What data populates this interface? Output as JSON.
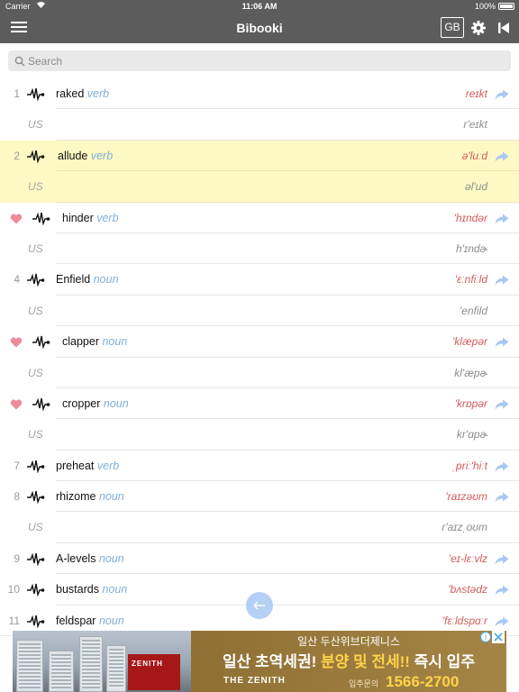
{
  "status_bar": {
    "carrier": "Carrier",
    "time": "11:06 AM",
    "battery": "100%"
  },
  "nav": {
    "title": "Bibooki",
    "lang_button": "GB"
  },
  "search": {
    "placeholder": "Search"
  },
  "entries": [
    {
      "num": "1",
      "fav": false,
      "word": "raked",
      "pos": "verb",
      "ipa": "reɪkt",
      "us_label": "US",
      "us_ipa": "r'eɪkt",
      "highlight": false
    },
    {
      "num": "2",
      "fav": false,
      "word": "allude",
      "pos": "verb",
      "ipa": "ə'luːd",
      "us_label": "US",
      "us_ipa": "əl'ud",
      "highlight": true
    },
    {
      "num": "",
      "fav": true,
      "word": "hinder",
      "pos": "verb",
      "ipa": "'hɪndər",
      "us_label": "US",
      "us_ipa": "h'ɪndɚ",
      "highlight": false
    },
    {
      "num": "4",
      "fav": false,
      "word": "Enfield",
      "pos": "noun",
      "ipa": "'ɛːnfiːld",
      "us_label": "US",
      "us_ipa": "'enfild",
      "highlight": false
    },
    {
      "num": "",
      "fav": true,
      "word": "clapper",
      "pos": "noun",
      "ipa": "'klæpər",
      "us_label": "US",
      "us_ipa": "kl'æpɚ",
      "highlight": false
    },
    {
      "num": "",
      "fav": true,
      "word": "cropper",
      "pos": "noun",
      "ipa": "'krɒpər",
      "us_label": "US",
      "us_ipa": "kr'ɑpɚ",
      "highlight": false
    },
    {
      "num": "7",
      "fav": false,
      "word": "preheat",
      "pos": "verb",
      "ipa": "ˌpriː'hiːt",
      "highlight": false
    },
    {
      "num": "8",
      "fav": false,
      "word": "rhizome",
      "pos": "noun",
      "ipa": "'raɪzəʊm",
      "us_label": "US",
      "us_ipa": "r'aɪzˌoʊm",
      "highlight": false
    },
    {
      "num": "9",
      "fav": false,
      "word": "A-levels",
      "pos": "noun",
      "ipa": "'eɪ-lɛːvlz",
      "highlight": false
    },
    {
      "num": "10",
      "fav": false,
      "word": "bustards",
      "pos": "noun",
      "ipa": "'bʌstədz",
      "highlight": false
    },
    {
      "num": "11",
      "fav": false,
      "word": "feldspar",
      "pos": "noun",
      "ipa": "'fɛːldspɑːr",
      "highlight": false
    }
  ],
  "ad": {
    "top_line": "일산 두산위브더제니스",
    "main_pre": "일산 초역세권! ",
    "main_mid": "분양 및 전세!! ",
    "main_post": "즉시 입주",
    "brand": "THE ZENITH",
    "sign_text": "ZENITH",
    "phone_label": "입주문의",
    "phone": "1566-2700",
    "info": "i"
  },
  "colors": {
    "nav_bg": "#5c5c5c",
    "highlight_row": "#fdf9c4",
    "heart": "#f08a9a",
    "pos_text": "#7fb0d8",
    "ipa_text": "#d35c5c",
    "share_icon": "#a8c8f3"
  }
}
